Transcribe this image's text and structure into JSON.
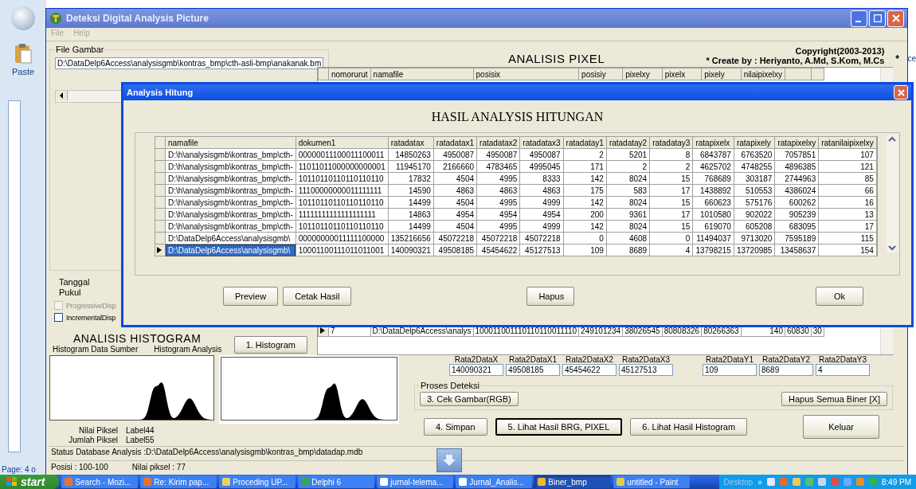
{
  "word_background": {
    "paste_label": "Paste",
    "ribbon_fragment": "ce",
    "page_status": "Page: 4 o"
  },
  "window": {
    "title": "Deteksi Digital Analysis Picture",
    "menu": [
      {
        "label": "File",
        "disabled": true
      },
      {
        "label": "Help",
        "disabled": true
      }
    ]
  },
  "file_group": {
    "title": "File Gambar",
    "path": "D:\\DataDelp6Access\\analysisgmb\\kontras_bmp\\cth-asli-bmp\\anakanak.bm"
  },
  "date_labels": [
    "Tanggal",
    "Pukul"
  ],
  "checkboxes": [
    {
      "label": "ProgressiveDisp",
      "checked": false,
      "disabled": true
    },
    {
      "label": "IncrementalDisp",
      "checked": false,
      "disabled": false
    }
  ],
  "histogram": {
    "title": "ANALISIS HISTOGRAM",
    "source_label": "Histogram Data Sumber",
    "analysis_label": "Histogram Analysis",
    "button": "1. Histogram",
    "stats": [
      {
        "label": "Nilai Piksel",
        "value": "Label44"
      },
      {
        "label": "Jumlah Piksel",
        "value": "Label55"
      }
    ]
  },
  "pixel": {
    "title": "ANALISIS PIXEL",
    "copyright": "Copyright(2003-2013)",
    "credit": "* Create by : Heriyanto, A.Md, S.Kom, M.Cs",
    "star": "*",
    "columns": [
      "nomorurut",
      "namafile",
      "posisix",
      "posisiy",
      "pixelxy",
      "pixelx",
      "pixely",
      "nilaipixelxy"
    ],
    "rows": [
      {
        "selected": true,
        "cells": [
          "7",
          "D:\\DataDelp6Access\\analys",
          "100011001110110110011110",
          "249101234",
          "38026545",
          "80808326",
          "80266363",
          "140",
          "60830",
          "30"
        ]
      }
    ]
  },
  "averages": [
    {
      "label": "Rata2DataX",
      "value": "140090321"
    },
    {
      "label": "Rata2DataX1",
      "value": "49508185"
    },
    {
      "label": "Rata2DataX2",
      "value": "45454622"
    },
    {
      "label": "Rata2DataX3",
      "value": "45127513"
    },
    {
      "label": "Rata2DataY1",
      "value": "109"
    },
    {
      "label": "Rata2DataY2",
      "value": "8689"
    },
    {
      "label": "Rata2DataY3",
      "value": "4"
    }
  ],
  "detection": {
    "title": "Proses Deteksi",
    "buttons": [
      "3. Cek Gambar(RGB)",
      "Hapus Semua Biner [X]"
    ]
  },
  "actions": [
    {
      "label": "4. Simpan",
      "default": false
    },
    {
      "label": "5. Lihat Hasil BRG, PIXEL",
      "default": true
    },
    {
      "label": "6. Lihat Hasil Histogram",
      "default": false
    },
    {
      "label": "Keluar",
      "default": false
    }
  ],
  "status_bar": {
    "database": "Status Database Analysis  :D:\\DataDelp6Access\\analysisgmb\\kontras_bmp\\datadap.mdb",
    "position": "Posisi : 100-100",
    "pixel_value": "Nilai piksel  : 77"
  },
  "dialog": {
    "title": "Analysis Hitung",
    "heading": "HASIL ANALYSIS HITUNGAN",
    "columns": [
      "namafile",
      "dokumen1",
      "ratadatax",
      "ratadatax1",
      "ratadatax2",
      "ratadatax3",
      "ratadatay1",
      "ratadatay2",
      "ratadatay3",
      "ratapixelx",
      "ratapixely",
      "ratapixelxy",
      "ratanilaipixelxy"
    ],
    "rows": [
      {
        "selected": false,
        "cells": [
          "D:\\h\\analysisgmb\\kontras_bmp\\cth-",
          "00000011100011100011",
          "14850263",
          "4950087",
          "4950087",
          "4950087",
          "2",
          "5201",
          "8",
          "6843787",
          "6763520",
          "7057851",
          "107"
        ]
      },
      {
        "selected": false,
        "cells": [
          "D:\\h\\analysisgmb\\kontras_bmp\\cth-",
          "11011011000000000001",
          "11945170",
          "2166660",
          "4783465",
          "4995045",
          "171",
          "2",
          "2",
          "4625702",
          "4748255",
          "4896385",
          "121"
        ]
      },
      {
        "selected": false,
        "cells": [
          "D:\\h\\analysisgmb\\kontras_bmp\\cth-",
          "10110110110110110110",
          "17832",
          "4504",
          "4995",
          "8333",
          "142",
          "8024",
          "15",
          "768689",
          "303187",
          "2744963",
          "85"
        ]
      },
      {
        "selected": false,
        "cells": [
          "D:\\h\\analysisgmb\\kontras_bmp\\cth-",
          "11100000000011111111",
          "14590",
          "4863",
          "4863",
          "4863",
          "175",
          "583",
          "17",
          "1438892",
          "510553",
          "4386024",
          "66"
        ]
      },
      {
        "selected": false,
        "cells": [
          "D:\\h\\analysisgmb\\kontras_bmp\\cth-",
          "10110110110110110110",
          "14499",
          "4504",
          "4995",
          "4999",
          "142",
          "8024",
          "15",
          "660623",
          "575176",
          "600262",
          "16"
        ]
      },
      {
        "selected": false,
        "cells": [
          "D:\\h\\analysisgmb\\kontras_bmp\\cth-",
          "11111111111111111111",
          "14863",
          "4954",
          "4954",
          "4954",
          "200",
          "9361",
          "17",
          "1010580",
          "902022",
          "905239",
          "13"
        ]
      },
      {
        "selected": false,
        "cells": [
          "D:\\h\\analysisgmb\\kontras_bmp\\cth-",
          "10110110110110110110",
          "14499",
          "4504",
          "4995",
          "4999",
          "142",
          "8024",
          "15",
          "619070",
          "605208",
          "683095",
          "17"
        ]
      },
      {
        "selected": false,
        "cells": [
          "D:\\DataDelp6Access\\analysisgmb\\",
          "00000000011111100000",
          "135216656",
          "45072218",
          "45072218",
          "45072218",
          "0",
          "4608",
          "0",
          "11494037",
          "9713020",
          "7595189",
          "115"
        ]
      },
      {
        "selected": true,
        "cells": [
          "D:\\DataDelp6Access\\analysisgmb\\",
          "10001100111011011001",
          "140090321",
          "49508185",
          "45454622",
          "45127513",
          "109",
          "8689",
          "4",
          "13798215",
          "13720985",
          "13458637",
          "154"
        ]
      }
    ],
    "buttons": [
      "Preview",
      "Cetak Hasil",
      "Hapus",
      "Ok"
    ]
  },
  "taskbar": {
    "start": "start",
    "items": [
      {
        "label": "Search - Mozi...",
        "selected": false
      },
      {
        "label": "Re: Kirim pap...",
        "selected": false
      },
      {
        "label": "Proceding UP...",
        "selected": false
      },
      {
        "label": "Delphi 6",
        "selected": false
      },
      {
        "label": "jurnal-telema...",
        "selected": false
      },
      {
        "label": "Jurnal_Analis...",
        "selected": false
      },
      {
        "label": "Biner_bmp",
        "selected": true
      },
      {
        "label": "untitled - Paint",
        "selected": false
      }
    ],
    "desktop": "Desktop",
    "chevron": "»",
    "time": "8:49 PM"
  }
}
